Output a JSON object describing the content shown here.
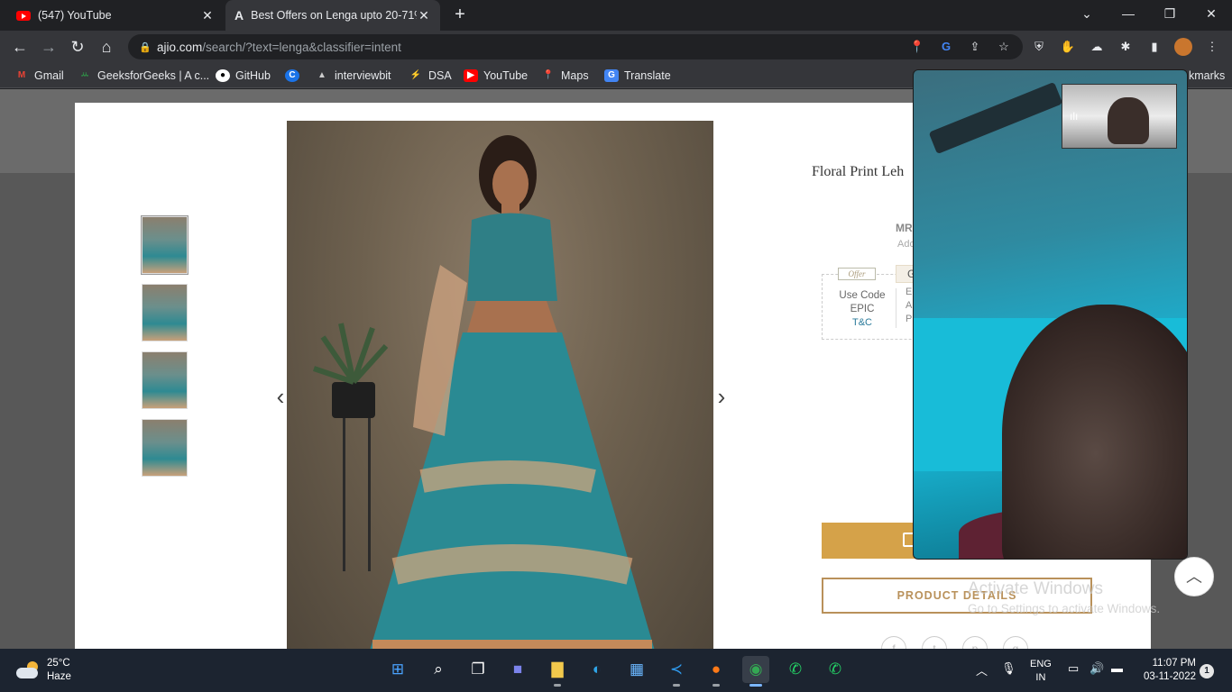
{
  "browser": {
    "tabs": [
      {
        "title": "(547) YouTube",
        "active": false
      },
      {
        "title": "Best Offers on Lenga upto 20-71%",
        "active": true
      }
    ],
    "url_host": "ajio.com",
    "url_path": "/search/?text=lenga&classifier=intent",
    "bookmarks": [
      {
        "label": "Gmail",
        "icon": "gmail-icon",
        "color": "#ea4335"
      },
      {
        "label": "GeeksforGeeks | A c...",
        "icon": "gfg-icon",
        "color": "#2f8d46"
      },
      {
        "label": "GitHub",
        "icon": "github-icon",
        "color": "#ffffff"
      },
      {
        "label": "",
        "icon": "codechef-icon",
        "color": "#1a73e8"
      },
      {
        "label": "interviewbit",
        "icon": "interviewbit-icon",
        "color": "#cccccc"
      },
      {
        "label": "DSA",
        "icon": "dsa-icon",
        "color": "#b34df0"
      },
      {
        "label": "YouTube",
        "icon": "youtube-icon",
        "color": "#ff0000"
      },
      {
        "label": "Maps",
        "icon": "maps-icon",
        "color": "#34a853"
      },
      {
        "label": "Translate",
        "icon": "translate-icon",
        "color": "#4285f4"
      }
    ],
    "bookmarks_overflow": "kmarks"
  },
  "product": {
    "title": "Floral Print Leh",
    "mrp_label": "MR",
    "addl_label": "Ado",
    "offer_tag": "Offer",
    "use_code_label": "Use Code",
    "code": "EPIC",
    "tc_label": "T&C",
    "g_label": "G",
    "offer_desc": [
      "E",
      "A",
      "P"
    ],
    "details_button": "PRODUCT DETAILS",
    "thumbnails": [
      "thumb-1",
      "thumb-2",
      "thumb-3",
      "thumb-4"
    ]
  },
  "watermark": {
    "line1": "Activate Windows",
    "line2": "Go to Settings to activate Windows."
  },
  "taskbar": {
    "temperature": "25°C",
    "weather": "Haze",
    "lang1": "ENG",
    "lang2": "IN",
    "time": "11:07 PM",
    "date": "03-11-2022",
    "notifications": "1"
  }
}
